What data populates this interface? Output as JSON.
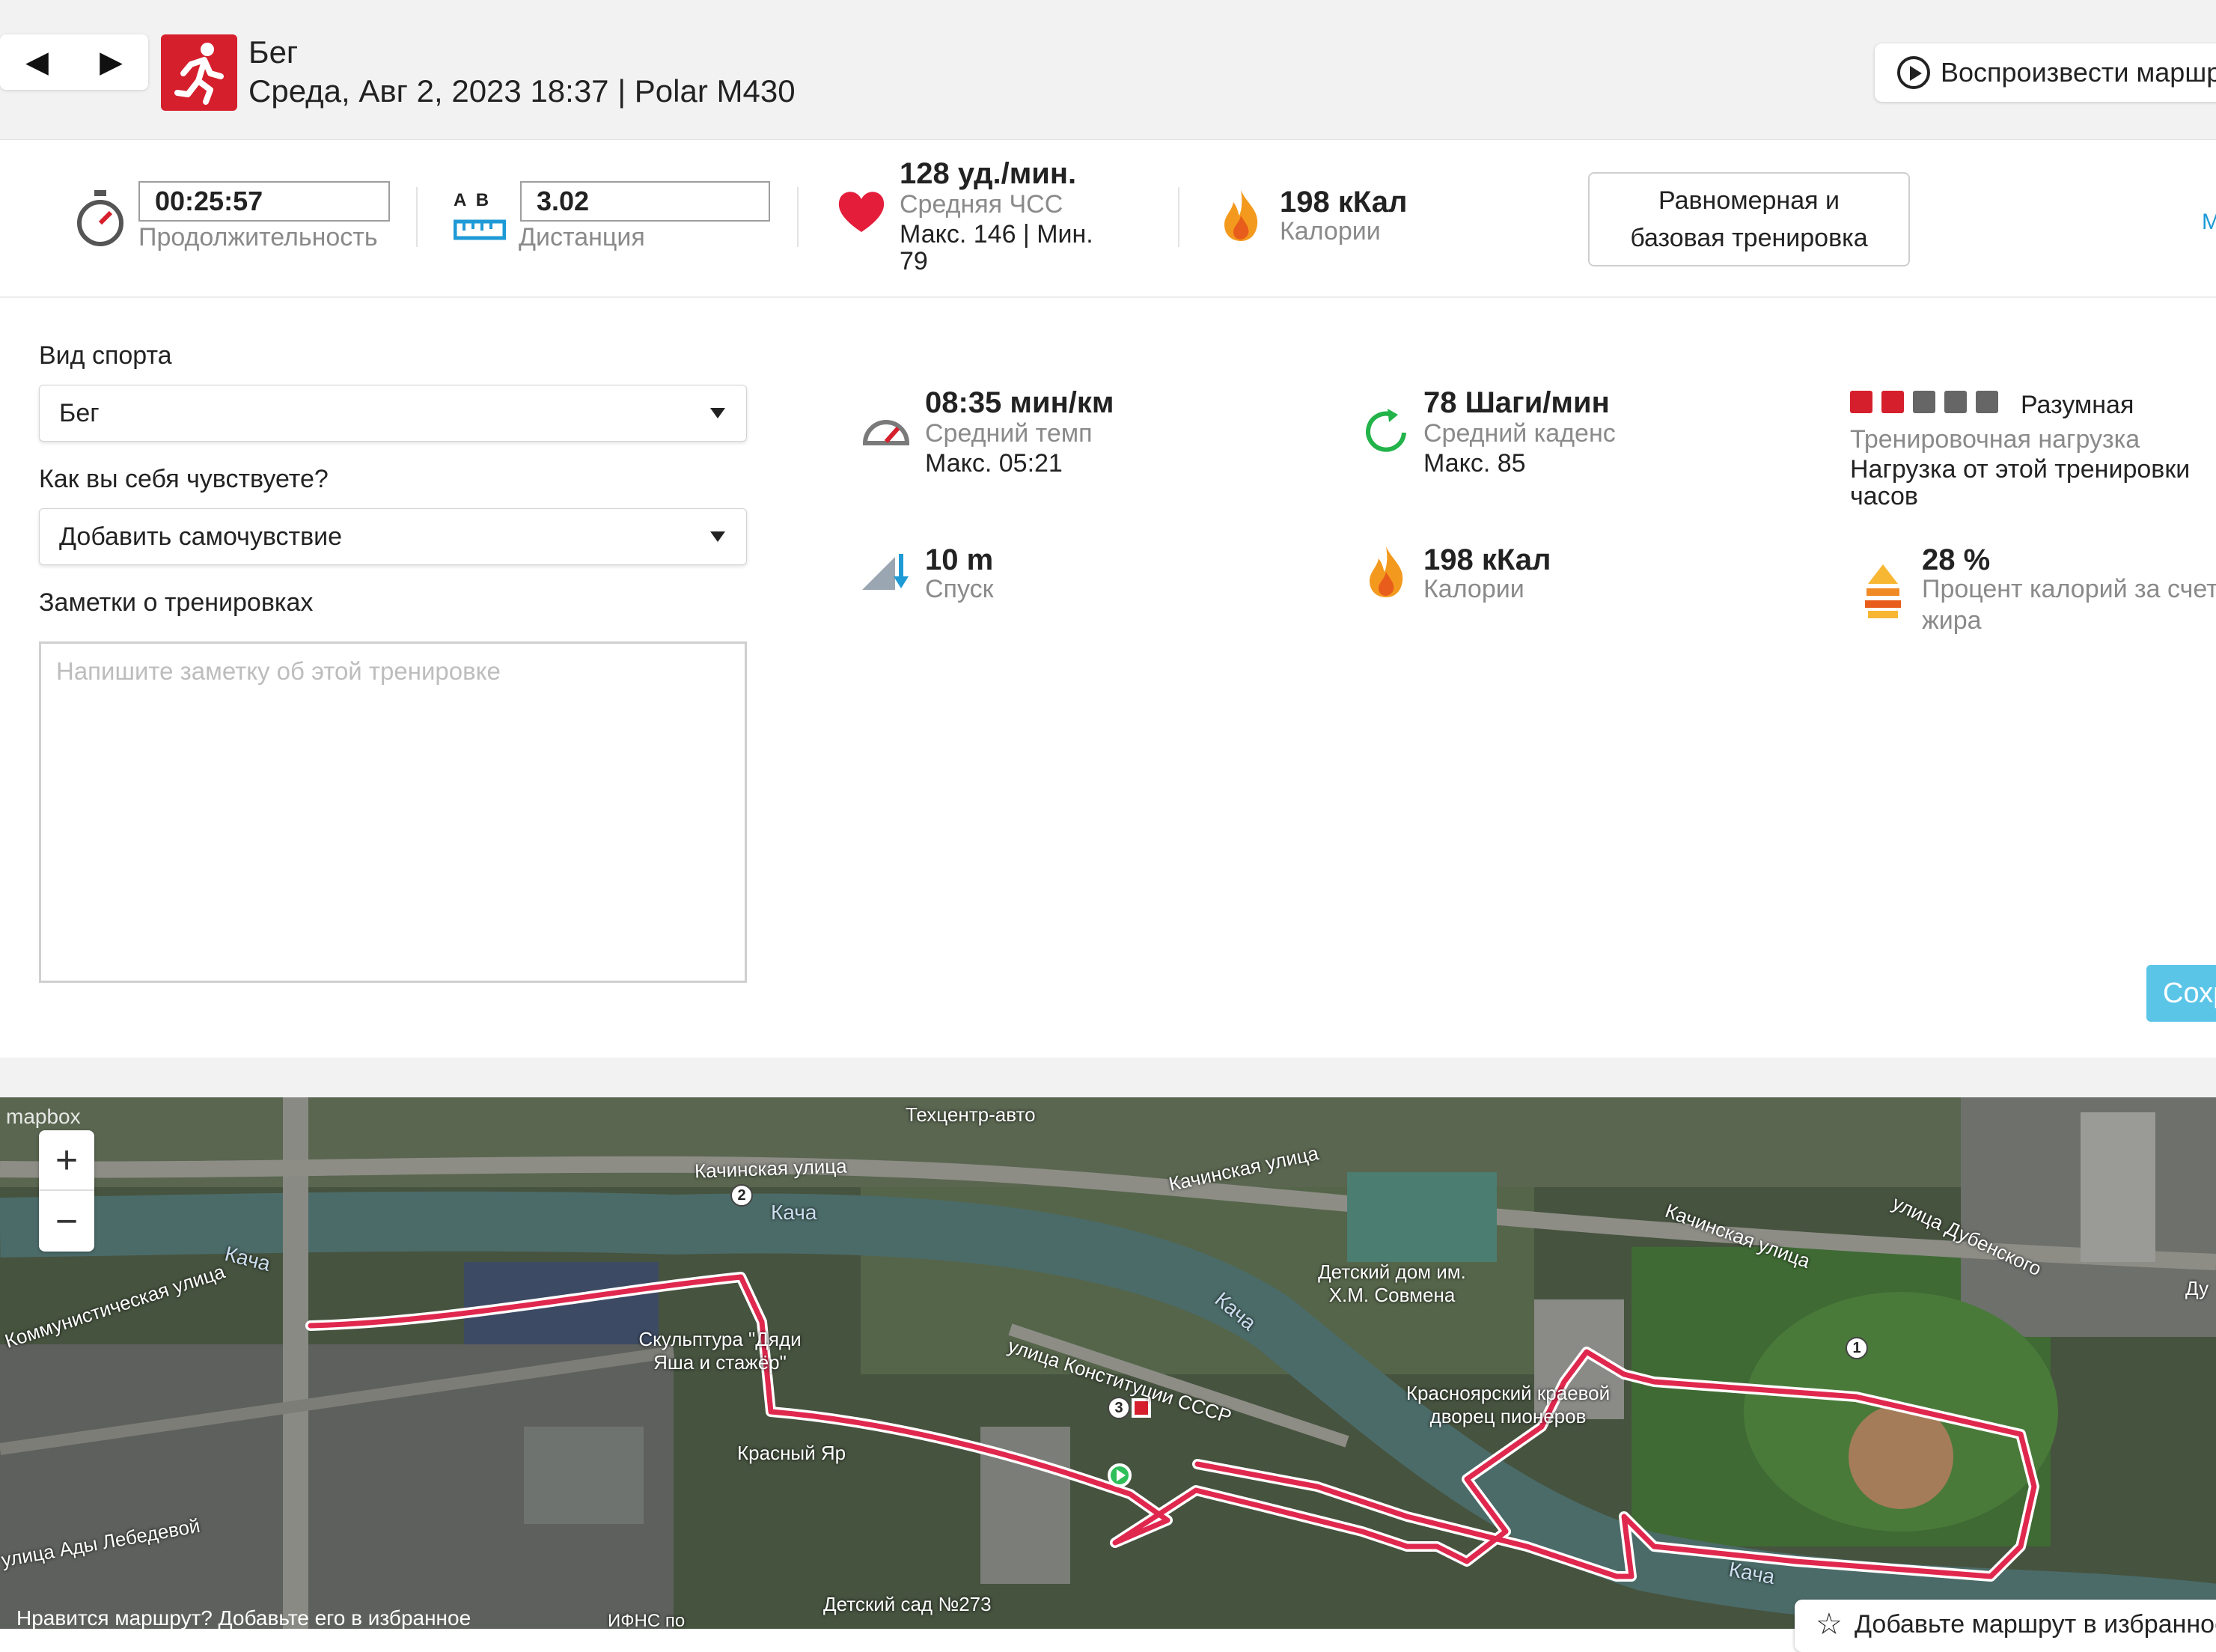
{
  "header": {
    "prev_label": "◀",
    "next_label": "▶",
    "sport": "Бег",
    "date_device": "Среда, Авг 2, 2023 18:37 | Polar M430",
    "replay_label": "Воспроизвести маршрут"
  },
  "summary": {
    "duration_value": "00:25:57",
    "duration_label": "Продолжительность",
    "distance_ab": "A  B",
    "distance_value": "3.02",
    "distance_label": "Дистанция",
    "hr_value": "128 уд./мин.",
    "hr_label": "Средняя ЧСС",
    "hr_range_line1": "Макс. 146  |  Мин.",
    "hr_range_line2": "79",
    "calories_value": "198 кКал",
    "calories_label": "Калории",
    "training_type_line1": "Равномерная и",
    "training_type_line2": "базовая тренировка",
    "edge_link": "М"
  },
  "form": {
    "sport_label": "Вид спорта",
    "sport_selected": "Бег",
    "feeling_label": "Как вы себя чувствуете?",
    "feeling_selected": "Добавить самочувствие",
    "notes_label": "Заметки о тренировках",
    "notes_placeholder": "Напишите заметку об этой тренировке"
  },
  "metrics": {
    "pace_value": "08:35 мин/км",
    "pace_label": "Средний темп",
    "pace_max": "Макс. 05:21",
    "cadence_value": "78 Шаги/мин",
    "cadence_label": "Средний каденс",
    "cadence_max": "Макс. 85",
    "load_level": "Разумная",
    "load_label": "Тренировочная нагрузка",
    "load_text_line1": "Нагрузка от этой тренировки",
    "load_text_line2": "часов",
    "load_filled": 2,
    "load_total": 5,
    "descent_value": "10 m",
    "descent_label": "Спуск",
    "calories_value": "198 кКал",
    "calories_label": "Калории",
    "fat_value": "28 %",
    "fat_label_line1": "Процент калорий за счет",
    "fat_label_line2": "жира",
    "save_label": "Сохранить"
  },
  "colors": {
    "brand_red": "#d61f2c",
    "route": "#e0284e",
    "save_blue": "#5bc5e8",
    "load_off": "#666666"
  },
  "map": {
    "attribution": "mapbox",
    "zoom_in": "+",
    "zoom_out": "−",
    "like_text": "Нравится маршрут?  Добавьте его в избранное",
    "favorite_label": "Добавьте маршрут в избранное",
    "labels": [
      "Техцентр-авто",
      "Качинская улица",
      "Качинская улица",
      "Качинская улица",
      "улица Дубенского",
      "Кача",
      "Кача",
      "Кача",
      "Кача",
      "Скульптура \"Дяди Яша и стажёр\"",
      "Красный Яр",
      "Детский дом им. Х.М. Совмена",
      "Красноярский краевой дворец пионеров",
      "улица Конституции СССР",
      "Коммунистическая улица",
      "улица Ады Лебедевой",
      "Детский сад №273",
      "ИФНС по",
      "Ду"
    ],
    "markers": [
      "1",
      "2",
      "3"
    ]
  }
}
